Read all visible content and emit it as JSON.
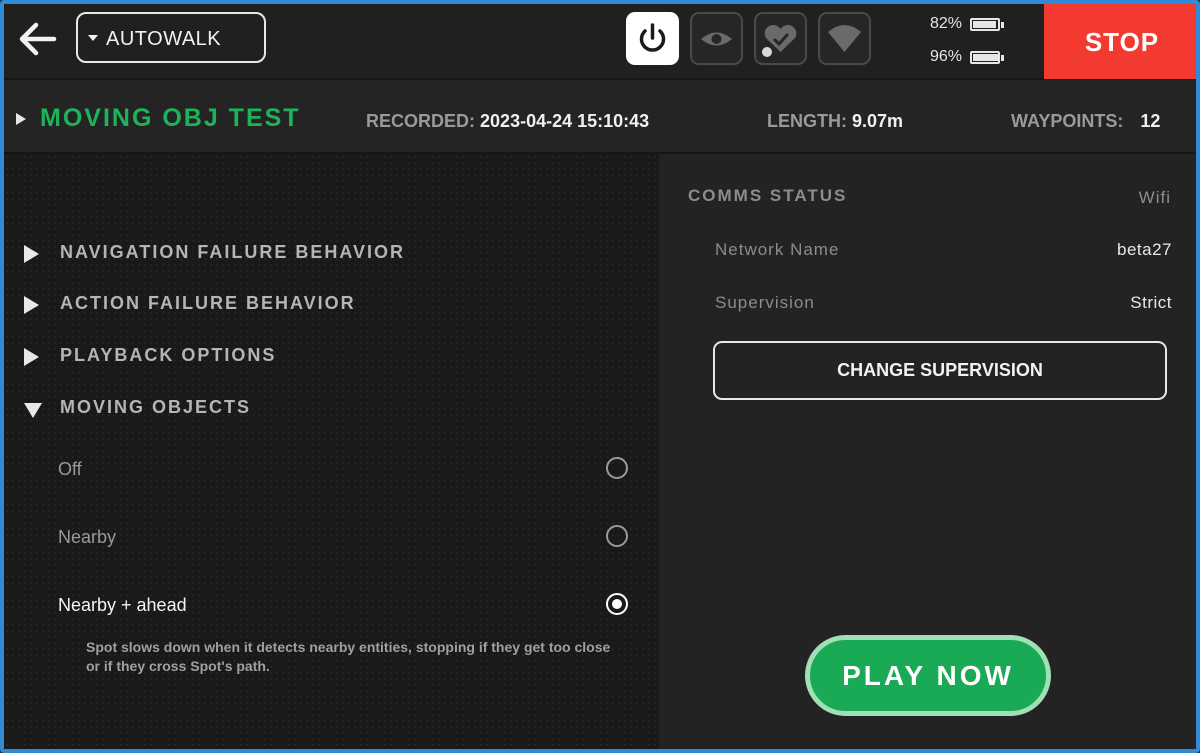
{
  "header": {
    "mode_label": "AUTOWALK",
    "battery_1": "82%",
    "battery_1_level": 0.82,
    "battery_2": "96%",
    "battery_2_level": 0.96,
    "stop_label": "STOP",
    "icons": [
      "back-arrow-icon",
      "power-icon",
      "eye-icon",
      "heart-check-icon",
      "wifi-icon",
      "battery-icon"
    ]
  },
  "mission": {
    "name": "MOVING OBJ TEST",
    "recorded_label": "RECORDED:",
    "recorded_value": "2023-04-24 15:10:43",
    "length_label": "LENGTH:",
    "length_value": "9.07m",
    "waypoints_label": "WAYPOINTS:",
    "waypoints_value": "12"
  },
  "sections": [
    {
      "label": "NAVIGATION FAILURE BEHAVIOR",
      "expanded": false
    },
    {
      "label": "ACTION FAILURE BEHAVIOR",
      "expanded": false
    },
    {
      "label": "PLAYBACK OPTIONS",
      "expanded": false
    },
    {
      "label": "MOVING OBJECTS",
      "expanded": true
    }
  ],
  "moving_objects": {
    "options": [
      {
        "label": "Off",
        "selected": false
      },
      {
        "label": "Nearby",
        "selected": false
      },
      {
        "label": "Nearby + ahead",
        "selected": true
      }
    ],
    "description": "Spot slows down when it detects nearby entities, stopping if they get too close or if they cross Spot's path."
  },
  "comms": {
    "title": "COMMS STATUS",
    "type": "Wifi",
    "network_label": "Network Name",
    "network_value": "beta27",
    "supervision_label": "Supervision",
    "supervision_value": "Strict",
    "change_button": "CHANGE SUPERVISION"
  },
  "play_button": "PLAY NOW",
  "colors": {
    "accent_green": "#1db35a",
    "stop_red": "#f23a30",
    "frame_blue": "#2f8bd6"
  }
}
